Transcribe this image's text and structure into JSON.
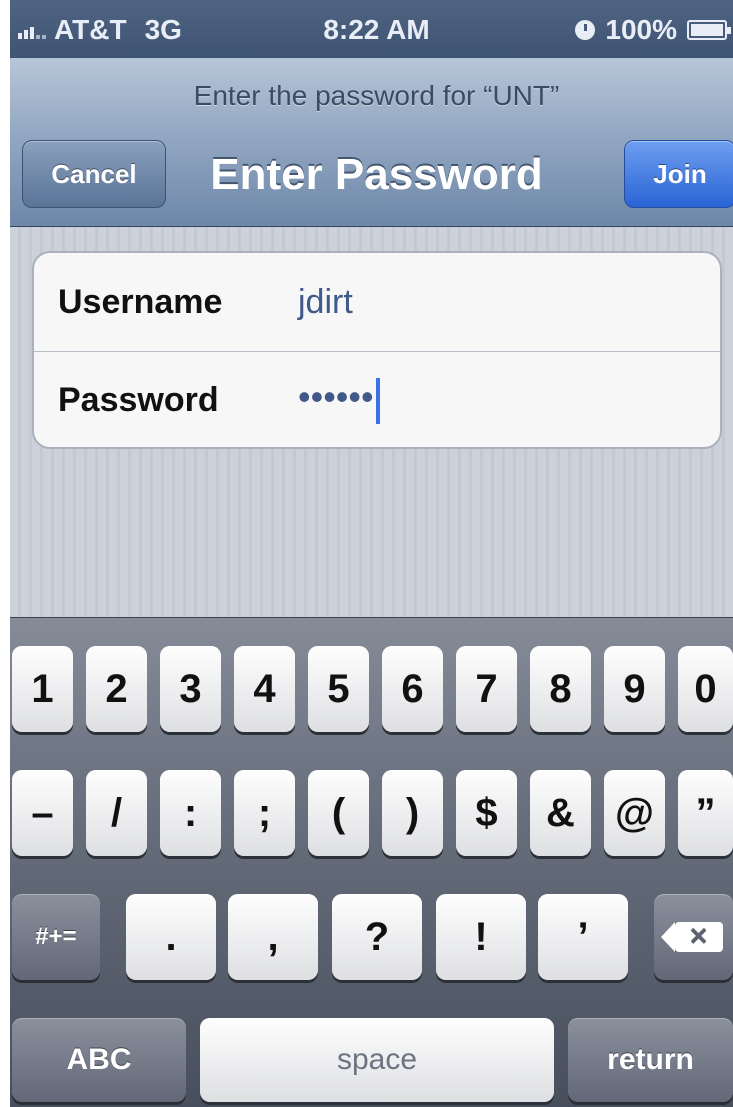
{
  "status_bar": {
    "carrier": "AT&T",
    "network": "3G",
    "time": "8:22 AM",
    "battery": "100%"
  },
  "nav": {
    "prompt": "Enter the password for “UNT”",
    "title": "Enter Password",
    "cancel_label": "Cancel",
    "join_label": "Join"
  },
  "form": {
    "username_label": "Username",
    "username_value": "jdirt",
    "password_label": "Password",
    "password_value": "••••••"
  },
  "keyboard": {
    "row1": [
      "1",
      "2",
      "3",
      "4",
      "5",
      "6",
      "7",
      "8",
      "9",
      "0"
    ],
    "row2": [
      "–",
      "/",
      ":",
      ";",
      "(",
      ")",
      "$",
      "&",
      "@",
      "”"
    ],
    "row3": [
      ".",
      ",",
      "?",
      "!",
      "’"
    ],
    "toggle_symbols_label": "#+=",
    "delete_label": "✕",
    "abc_label": "ABC",
    "space_label": "space",
    "return_label": "return"
  },
  "icons": {
    "signal": "signal-bars-icon",
    "alarm": "clock-icon",
    "battery": "battery-icon",
    "delete": "delete-backspace-icon"
  }
}
